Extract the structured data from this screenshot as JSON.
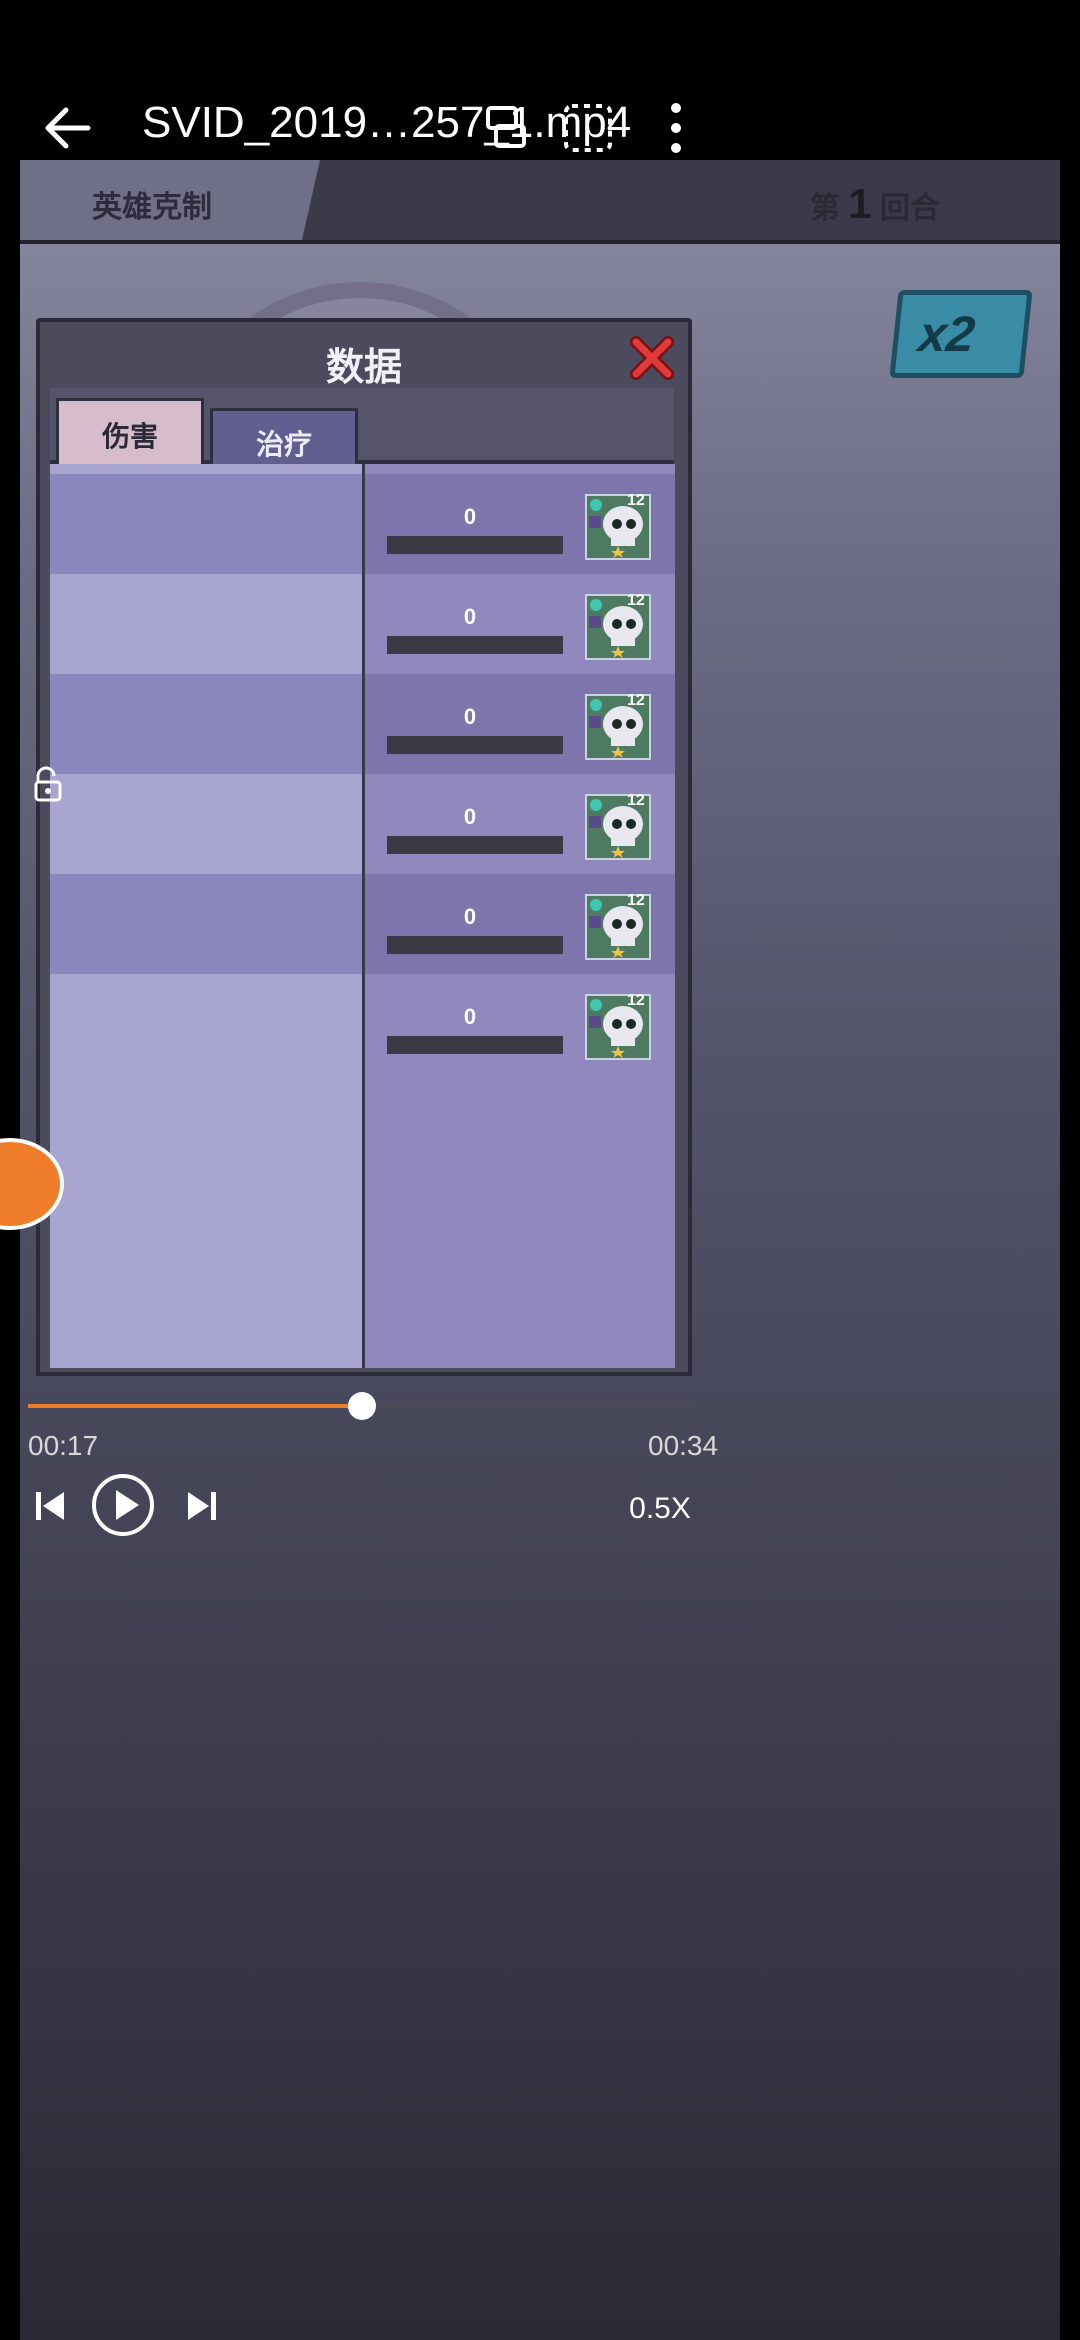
{
  "player": {
    "file_name": "SVID_2019…257_1.mp4",
    "current_time": "00:17",
    "duration": "00:34",
    "progress_fraction": 0.5,
    "speed_label": "0.5X",
    "accent_color": "#f07d2a"
  },
  "game": {
    "hero_counter_tab": "英雄克制",
    "round_prefix": "第",
    "round_number": "1",
    "round_suffix": "回合",
    "speed_badge": "x2"
  },
  "dialog": {
    "title": "数据",
    "tabs": [
      {
        "label": "伤害",
        "active": true
      },
      {
        "label": "治疗",
        "active": false
      }
    ],
    "rows": [
      {
        "value": "0",
        "level": "12"
      },
      {
        "value": "0",
        "level": "12"
      },
      {
        "value": "0",
        "level": "12"
      },
      {
        "value": "0",
        "level": "12"
      },
      {
        "value": "0",
        "level": "12"
      },
      {
        "value": "0",
        "level": "12"
      }
    ]
  },
  "icons": [
    "back-arrow-icon",
    "rotate-icon",
    "fullscreen-icon",
    "more-icon",
    "close-icon",
    "lock-icon",
    "previous-icon",
    "play-icon",
    "next-icon",
    "skull-portrait-icon"
  ]
}
